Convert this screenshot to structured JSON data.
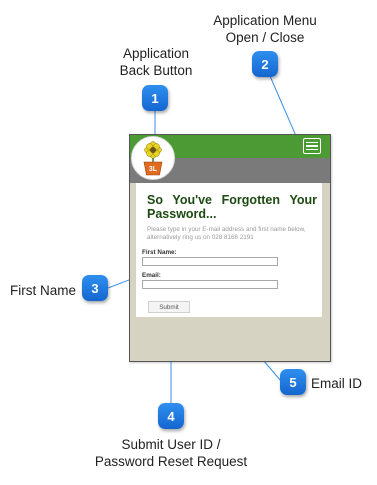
{
  "callouts": [
    {
      "number": "1",
      "text_line1": "Application",
      "text_line2": "Back Button"
    },
    {
      "number": "2",
      "text_line1": "Application Menu",
      "text_line2": "Open / Close"
    },
    {
      "number": "3",
      "text_line1": "First Name"
    },
    {
      "number": "4",
      "text_line1": "Submit User ID /",
      "text_line2": "Password Reset Request"
    },
    {
      "number": "5",
      "text_line1": "Email ID"
    }
  ],
  "phone": {
    "logo_text": "3L",
    "title": "So You've Forgotten Your Password...",
    "description": "Please type in your E-mail address and first name below, alternatively ring us on 028 8166 2191",
    "first_name_label": "First Name:",
    "email_label": "Email:",
    "submit_label": "Submit"
  },
  "colors": {
    "badge": "#1a73dc",
    "topbar": "#4c9a34",
    "graybar": "#7a7a7a",
    "connector": "#3a8fe8",
    "title": "#1d4a12"
  },
  "icons": {
    "menu": "hamburger-icon",
    "logo": "flower-pot-logo"
  }
}
